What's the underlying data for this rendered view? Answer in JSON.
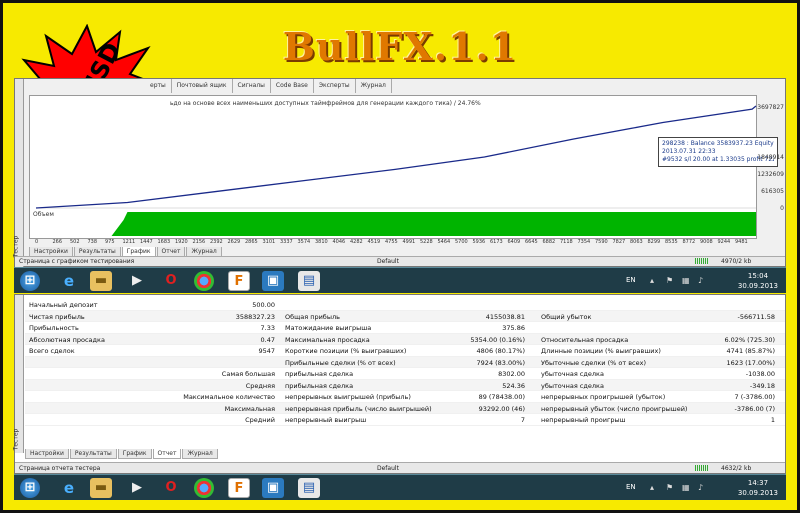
{
  "banner": {
    "title": "BullFX.1.1",
    "price_badge": "50 USD",
    "colors": {
      "background": "#f7ea00",
      "title": "#e07800",
      "badge": "#ff0000"
    }
  },
  "chart_window": {
    "top_tabs": [
      "ерты",
      "Почтовый ящик",
      "Сигналы",
      "Code Base",
      "Эксперты",
      "Журнал"
    ],
    "side_label": "Тестер",
    "chart_header": "ьдо на основе всех наименьших доступных таймфреймов для генерации каждого тика) / 24.76%",
    "tooltip": {
      "line1": "298238 : Balance 3583937.23 Equity 3583937.23",
      "line2": "2013.07.31 22:33",
      "line3": "#9532 s/l 20.00 at 1.33035 profit 722.00"
    },
    "y_ticks": [
      "3697827",
      "1848914",
      "1232609",
      "616305",
      "0"
    ],
    "volume_label": "Объем",
    "x_ticks": [
      "0",
      "266",
      "502",
      "738",
      "975",
      "1211",
      "1447",
      "1683",
      "1920",
      "2156",
      "2392",
      "2629",
      "2865",
      "3101",
      "3337",
      "3574",
      "3810",
      "4046",
      "4282",
      "4519",
      "4755",
      "4991",
      "5228",
      "5464",
      "5700",
      "5936",
      "6173",
      "6409",
      "6645",
      "6882",
      "7118",
      "7354",
      "7590",
      "7827",
      "8063",
      "8299",
      "8535",
      "8772",
      "9008",
      "9244",
      "9481"
    ],
    "bottom_tabs": [
      "Настройки",
      "Результаты",
      "График",
      "Отчет",
      "Журнал"
    ],
    "active_tab": "График",
    "status_left": "Страница с графиком тестирования",
    "status_mid": "Default",
    "status_right": "4970/2 kb"
  },
  "chart_data": {
    "type": "line",
    "series": [
      {
        "name": "Balance",
        "color": "#1a2a8a",
        "x": [
          0,
          1211,
          2392,
          3574,
          4755,
          5936,
          7118,
          8299,
          9481,
          9532
        ],
        "y": [
          0,
          200000,
          600000,
          1000000,
          1400000,
          1850000,
          2500000,
          3100000,
          3583937,
          3697827
        ]
      }
    ],
    "volume_color": "#00b400",
    "ylim": [
      0,
      3697827
    ],
    "xlim": [
      0,
      9532
    ]
  },
  "taskbar1": {
    "lang": "EN",
    "time": "15:04",
    "date": "30.09.2013"
  },
  "taskbar2": {
    "lang": "EN",
    "time": "14:37",
    "date": "30.09.2013"
  },
  "report_window": {
    "side_label": "Тестер",
    "rows": [
      {
        "c1": "Начальный депозит",
        "c2": "500.00",
        "c3": "",
        "c4": "",
        "c5": "",
        "c6": ""
      },
      {
        "c1": "Чистая прибыль",
        "c2": "3588327.23",
        "c3": "Общая прибыль",
        "c4": "4155038.81",
        "c5": "Общий убыток",
        "c6": "-566711.58"
      },
      {
        "c1": "Прибыльность",
        "c2": "7.33",
        "c3": "Матожидание выигрыша",
        "c4": "375.86",
        "c5": "",
        "c6": ""
      },
      {
        "c1": "Абсолютная просадка",
        "c2": "0.47",
        "c3": "Максимальная просадка",
        "c4": "5354.00 (0.16%)",
        "c5": "Относительная просадка",
        "c6": "6.02% (725.30)"
      },
      {
        "c1": "Всего сделок",
        "c2": "9547",
        "c3": "Короткие позиции (% выигравших)",
        "c4": "4806 (80.17%)",
        "c5": "Длинные позиции (% выигравших)",
        "c6": "4741 (85.87%)"
      },
      {
        "c1": "",
        "c2": "",
        "c3": "Прибыльные сделки (% от всех)",
        "c4": "7924 (83.00%)",
        "c5": "Убыточные сделки (% от всех)",
        "c6": "1623 (17.00%)"
      },
      {
        "c1r": "Самая большая",
        "c3": "прибыльная сделка",
        "c4": "8302.00",
        "c5": "убыточная сделка",
        "c6": "-1038.00"
      },
      {
        "c1r": "Средняя",
        "c3": "прибыльная сделка",
        "c4": "524.36",
        "c5": "убыточная сделка",
        "c6": "-349.18"
      },
      {
        "c1r": "Максимальное количество",
        "c3": "непрерывных выигрышей (прибыль)",
        "c4": "89 (78438.00)",
        "c5": "непрерывных проигрышей (убыток)",
        "c6": "7 (-3786.00)"
      },
      {
        "c1r": "Максимальная",
        "c3": "непрерывная прибыль (число выигрышей)",
        "c4": "93292.00 (46)",
        "c5": "непрерывный убыток (число проигрышей)",
        "c6": "-3786.00 (7)"
      },
      {
        "c1r": "Средний",
        "c3": "непрерывный выигрыш",
        "c4": "7",
        "c5": "непрерывный проигрыш",
        "c6": "1"
      }
    ],
    "bottom_tabs": [
      "Настройки",
      "Результаты",
      "График",
      "Отчет",
      "Журнал"
    ],
    "active_tab": "Отчет",
    "status_left": "Страница отчета тестера",
    "status_mid": "Default",
    "status_right": "4632/2 kb"
  }
}
